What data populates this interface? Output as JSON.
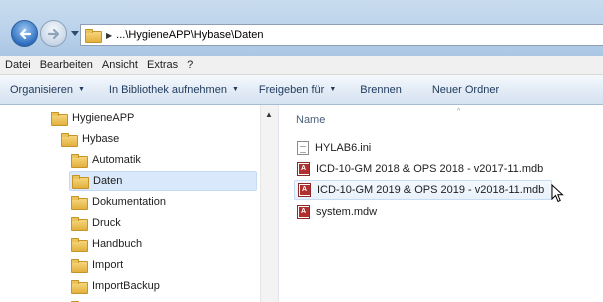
{
  "address": {
    "path": "...\\HygieneAPP\\Hybase\\Daten"
  },
  "menu": [
    "Datei",
    "Bearbeiten",
    "Ansicht",
    "Extras",
    "?"
  ],
  "commands": {
    "organize": "Organisieren",
    "library": "In Bibliothek aufnehmen",
    "share": "Freigeben für",
    "burn": "Brennen",
    "new_folder": "Neuer Ordner"
  },
  "tree": [
    {
      "label": "HygieneAPP",
      "level": 1
    },
    {
      "label": "Hybase",
      "level": 2
    },
    {
      "label": "Automatik",
      "level": 3
    },
    {
      "label": "Daten",
      "level": 3,
      "selected": true
    },
    {
      "label": "Dokumentation",
      "level": 3
    },
    {
      "label": "Druck",
      "level": 3
    },
    {
      "label": "Handbuch",
      "level": 3
    },
    {
      "label": "Import",
      "level": 3
    },
    {
      "label": "ImportBackup",
      "level": 3
    }
  ],
  "files": {
    "column_name": "Name",
    "items": [
      {
        "name": "HYLAB6.ini",
        "type": "ini"
      },
      {
        "name": "ICD-10-GM 2018 & OPS 2018 - v2017-11.mdb",
        "type": "mdb"
      },
      {
        "name": "ICD-10-GM 2019 & OPS 2019 - v2018-11.mdb",
        "type": "mdb",
        "hover": true
      },
      {
        "name": "system.mdw",
        "type": "mdw"
      }
    ]
  }
}
